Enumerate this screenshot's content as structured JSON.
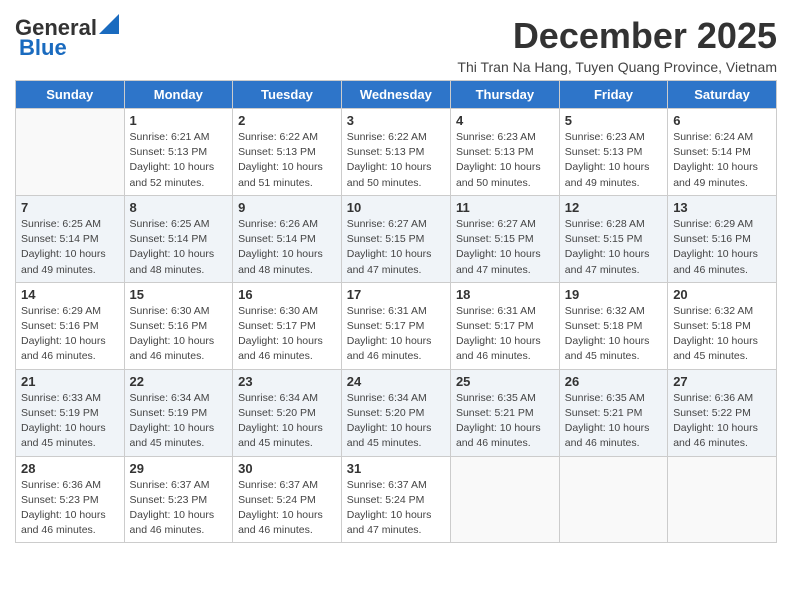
{
  "logo": {
    "general": "General",
    "blue": "Blue"
  },
  "header": {
    "month": "December 2025",
    "location": "Thi Tran Na Hang, Tuyen Quang Province, Vietnam"
  },
  "days_of_week": [
    "Sunday",
    "Monday",
    "Tuesday",
    "Wednesday",
    "Thursday",
    "Friday",
    "Saturday"
  ],
  "weeks": [
    [
      {
        "day": "",
        "sunrise": "",
        "sunset": "",
        "daylight": ""
      },
      {
        "day": "1",
        "sunrise": "Sunrise: 6:21 AM",
        "sunset": "Sunset: 5:13 PM",
        "daylight": "Daylight: 10 hours and 52 minutes."
      },
      {
        "day": "2",
        "sunrise": "Sunrise: 6:22 AM",
        "sunset": "Sunset: 5:13 PM",
        "daylight": "Daylight: 10 hours and 51 minutes."
      },
      {
        "day": "3",
        "sunrise": "Sunrise: 6:22 AM",
        "sunset": "Sunset: 5:13 PM",
        "daylight": "Daylight: 10 hours and 50 minutes."
      },
      {
        "day": "4",
        "sunrise": "Sunrise: 6:23 AM",
        "sunset": "Sunset: 5:13 PM",
        "daylight": "Daylight: 10 hours and 50 minutes."
      },
      {
        "day": "5",
        "sunrise": "Sunrise: 6:23 AM",
        "sunset": "Sunset: 5:13 PM",
        "daylight": "Daylight: 10 hours and 49 minutes."
      },
      {
        "day": "6",
        "sunrise": "Sunrise: 6:24 AM",
        "sunset": "Sunset: 5:14 PM",
        "daylight": "Daylight: 10 hours and 49 minutes."
      }
    ],
    [
      {
        "day": "7",
        "sunrise": "Sunrise: 6:25 AM",
        "sunset": "Sunset: 5:14 PM",
        "daylight": "Daylight: 10 hours and 49 minutes."
      },
      {
        "day": "8",
        "sunrise": "Sunrise: 6:25 AM",
        "sunset": "Sunset: 5:14 PM",
        "daylight": "Daylight: 10 hours and 48 minutes."
      },
      {
        "day": "9",
        "sunrise": "Sunrise: 6:26 AM",
        "sunset": "Sunset: 5:14 PM",
        "daylight": "Daylight: 10 hours and 48 minutes."
      },
      {
        "day": "10",
        "sunrise": "Sunrise: 6:27 AM",
        "sunset": "Sunset: 5:15 PM",
        "daylight": "Daylight: 10 hours and 47 minutes."
      },
      {
        "day": "11",
        "sunrise": "Sunrise: 6:27 AM",
        "sunset": "Sunset: 5:15 PM",
        "daylight": "Daylight: 10 hours and 47 minutes."
      },
      {
        "day": "12",
        "sunrise": "Sunrise: 6:28 AM",
        "sunset": "Sunset: 5:15 PM",
        "daylight": "Daylight: 10 hours and 47 minutes."
      },
      {
        "day": "13",
        "sunrise": "Sunrise: 6:29 AM",
        "sunset": "Sunset: 5:16 PM",
        "daylight": "Daylight: 10 hours and 46 minutes."
      }
    ],
    [
      {
        "day": "14",
        "sunrise": "Sunrise: 6:29 AM",
        "sunset": "Sunset: 5:16 PM",
        "daylight": "Daylight: 10 hours and 46 minutes."
      },
      {
        "day": "15",
        "sunrise": "Sunrise: 6:30 AM",
        "sunset": "Sunset: 5:16 PM",
        "daylight": "Daylight: 10 hours and 46 minutes."
      },
      {
        "day": "16",
        "sunrise": "Sunrise: 6:30 AM",
        "sunset": "Sunset: 5:17 PM",
        "daylight": "Daylight: 10 hours and 46 minutes."
      },
      {
        "day": "17",
        "sunrise": "Sunrise: 6:31 AM",
        "sunset": "Sunset: 5:17 PM",
        "daylight": "Daylight: 10 hours and 46 minutes."
      },
      {
        "day": "18",
        "sunrise": "Sunrise: 6:31 AM",
        "sunset": "Sunset: 5:17 PM",
        "daylight": "Daylight: 10 hours and 46 minutes."
      },
      {
        "day": "19",
        "sunrise": "Sunrise: 6:32 AM",
        "sunset": "Sunset: 5:18 PM",
        "daylight": "Daylight: 10 hours and 45 minutes."
      },
      {
        "day": "20",
        "sunrise": "Sunrise: 6:32 AM",
        "sunset": "Sunset: 5:18 PM",
        "daylight": "Daylight: 10 hours and 45 minutes."
      }
    ],
    [
      {
        "day": "21",
        "sunrise": "Sunrise: 6:33 AM",
        "sunset": "Sunset: 5:19 PM",
        "daylight": "Daylight: 10 hours and 45 minutes."
      },
      {
        "day": "22",
        "sunrise": "Sunrise: 6:34 AM",
        "sunset": "Sunset: 5:19 PM",
        "daylight": "Daylight: 10 hours and 45 minutes."
      },
      {
        "day": "23",
        "sunrise": "Sunrise: 6:34 AM",
        "sunset": "Sunset: 5:20 PM",
        "daylight": "Daylight: 10 hours and 45 minutes."
      },
      {
        "day": "24",
        "sunrise": "Sunrise: 6:34 AM",
        "sunset": "Sunset: 5:20 PM",
        "daylight": "Daylight: 10 hours and 45 minutes."
      },
      {
        "day": "25",
        "sunrise": "Sunrise: 6:35 AM",
        "sunset": "Sunset: 5:21 PM",
        "daylight": "Daylight: 10 hours and 46 minutes."
      },
      {
        "day": "26",
        "sunrise": "Sunrise: 6:35 AM",
        "sunset": "Sunset: 5:21 PM",
        "daylight": "Daylight: 10 hours and 46 minutes."
      },
      {
        "day": "27",
        "sunrise": "Sunrise: 6:36 AM",
        "sunset": "Sunset: 5:22 PM",
        "daylight": "Daylight: 10 hours and 46 minutes."
      }
    ],
    [
      {
        "day": "28",
        "sunrise": "Sunrise: 6:36 AM",
        "sunset": "Sunset: 5:23 PM",
        "daylight": "Daylight: 10 hours and 46 minutes."
      },
      {
        "day": "29",
        "sunrise": "Sunrise: 6:37 AM",
        "sunset": "Sunset: 5:23 PM",
        "daylight": "Daylight: 10 hours and 46 minutes."
      },
      {
        "day": "30",
        "sunrise": "Sunrise: 6:37 AM",
        "sunset": "Sunset: 5:24 PM",
        "daylight": "Daylight: 10 hours and 46 minutes."
      },
      {
        "day": "31",
        "sunrise": "Sunrise: 6:37 AM",
        "sunset": "Sunset: 5:24 PM",
        "daylight": "Daylight: 10 hours and 47 minutes."
      },
      {
        "day": "",
        "sunrise": "",
        "sunset": "",
        "daylight": ""
      },
      {
        "day": "",
        "sunrise": "",
        "sunset": "",
        "daylight": ""
      },
      {
        "day": "",
        "sunrise": "",
        "sunset": "",
        "daylight": ""
      }
    ]
  ]
}
